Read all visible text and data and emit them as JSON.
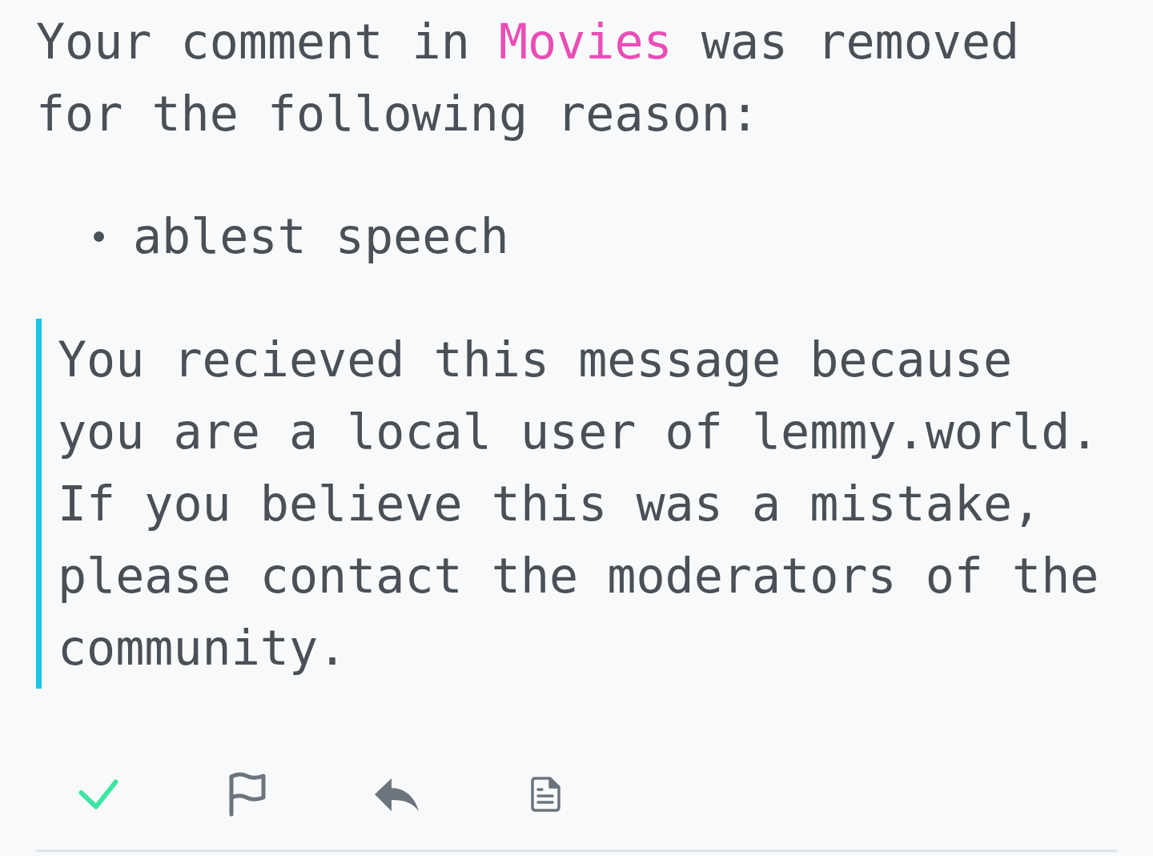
{
  "message": {
    "read": true,
    "text_before_link": "Your comment in",
    "community_link": "Movies",
    "text_after_link": "was removed for the following reason:",
    "reasons": [
      "ablest speech"
    ],
    "notice": "You recieved this message because you are a local user of lemmy.world. If you believe this was a mistake, please contact the moderators of the community."
  },
  "actions": [
    {
      "kind": "check"
    },
    {
      "kind": "flag"
    },
    {
      "kind": "reply"
    },
    {
      "kind": "source"
    }
  ]
}
